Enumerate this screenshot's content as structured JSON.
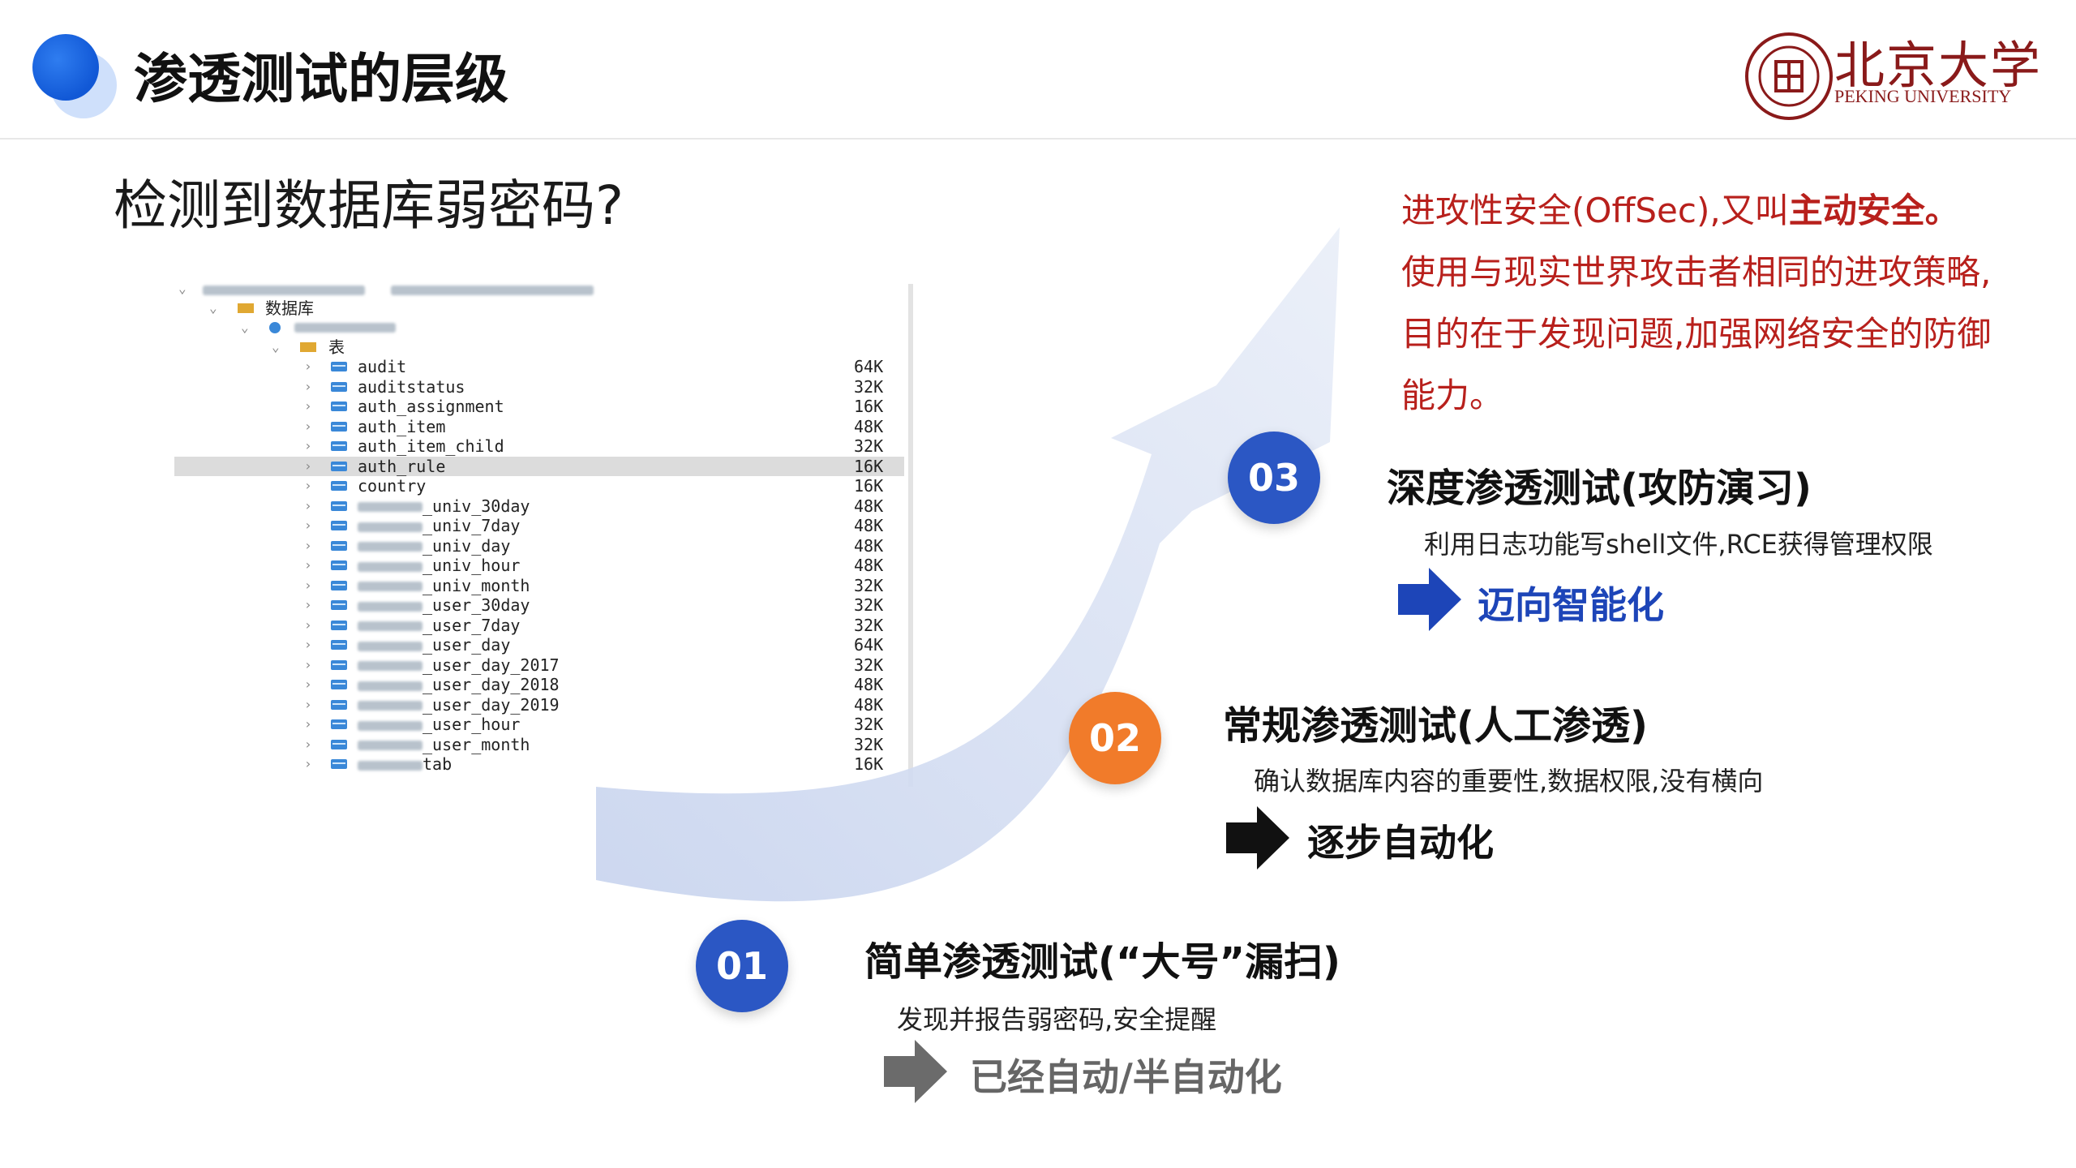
{
  "header": {
    "title": "渗透测试的层级",
    "logo_cn": "北京大学",
    "logo_en": "PEKING UNIVERSITY"
  },
  "question": "检测到数据库弱密码?",
  "db_tree": {
    "folder_label": "数据库",
    "tables_label": "表",
    "rows": [
      {
        "name": "audit",
        "size": "64K"
      },
      {
        "name": "auditstatus",
        "size": "32K"
      },
      {
        "name": "auth_assignment",
        "size": "16K"
      },
      {
        "name": "auth_item",
        "size": "48K"
      },
      {
        "name": "auth_item_child",
        "size": "32K"
      },
      {
        "name": "auth_rule",
        "size": "16K",
        "selected": true
      },
      {
        "name": "country",
        "size": "16K"
      },
      {
        "name": "_univ_30day",
        "size": "48K",
        "prefix_blurred": true
      },
      {
        "name": "_univ_7day",
        "size": "48K",
        "prefix_blurred": true
      },
      {
        "name": "_univ_day",
        "size": "48K",
        "prefix_blurred": true
      },
      {
        "name": "_univ_hour",
        "size": "48K",
        "prefix_blurred": true
      },
      {
        "name": "_univ_month",
        "size": "32K",
        "prefix_blurred": true
      },
      {
        "name": "_user_30day",
        "size": "32K",
        "prefix_blurred": true
      },
      {
        "name": "_user_7day",
        "size": "32K",
        "prefix_blurred": true
      },
      {
        "name": "_user_day",
        "size": "64K",
        "prefix_blurred": true
      },
      {
        "name": "_user_day_2017",
        "size": "32K",
        "prefix_blurred": true
      },
      {
        "name": "_user_day_2018",
        "size": "48K",
        "prefix_blurred": true
      },
      {
        "name": "_user_day_2019",
        "size": "48K",
        "prefix_blurred": true
      },
      {
        "name": "_user_hour",
        "size": "32K",
        "prefix_blurred": true
      },
      {
        "name": "_user_month",
        "size": "32K",
        "prefix_blurred": true
      },
      {
        "name": "tab",
        "size": "16K",
        "prefix_blurred": true
      }
    ]
  },
  "steps": [
    {
      "number": "01",
      "title": "简单渗透测试(“大号”漏扫)",
      "desc": "发现并报告弱密码,安全提醒",
      "arrow_text": "已经自动/半自动化"
    },
    {
      "number": "02",
      "title": "常规渗透测试(人工渗透)",
      "desc": "确认数据库内容的重要性,数据权限,没有横向",
      "arrow_text": "逐步自动化"
    },
    {
      "number": "03",
      "title": "深度渗透测试(攻防演习)",
      "desc": "利用日志功能写shell文件,RCE获得管理权限",
      "arrow_text": "迈向智能化"
    }
  ],
  "offsec": {
    "line1_pre": "进攻性安全(OffSec),又叫",
    "line1_bold": "主动安全。",
    "line2": "使用与现实世界攻击者相同的进攻策略,",
    "line3": "目的在于发现问题,加强网络安全的防御",
    "line4": "能力。"
  },
  "colors": {
    "step_blue": "#2b57c4",
    "step_orange": "#f17b2a",
    "offsec_red": "#b8201c",
    "smart_blue": "#1d45b8"
  }
}
